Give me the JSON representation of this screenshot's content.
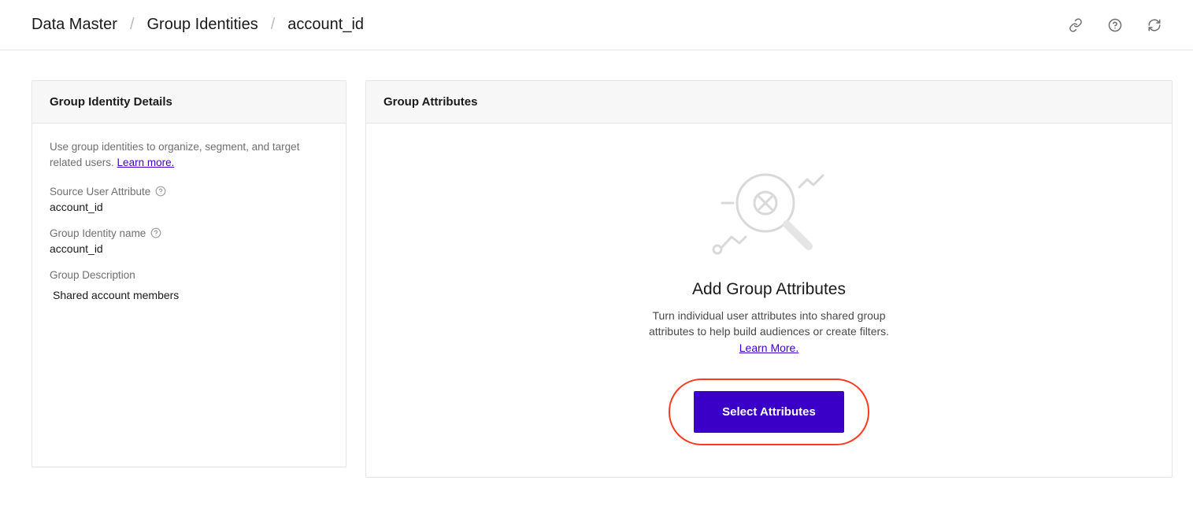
{
  "breadcrumb": {
    "root": "Data Master",
    "parent": "Group Identities",
    "current": "account_id"
  },
  "details_panel": {
    "title": "Group Identity Details",
    "intro_text": "Use group identities to organize, segment, and target related users. ",
    "learn_more": "Learn more.",
    "source_label": "Source User Attribute",
    "source_value": "account_id",
    "name_label": "Group Identity name",
    "name_value": "account_id",
    "desc_label": "Group Description",
    "desc_value": "Shared account members"
  },
  "attributes_panel": {
    "title": "Group Attributes",
    "empty_title": "Add Group Attributes",
    "empty_desc": "Turn individual user attributes into shared group attributes to help build audiences or create filters.",
    "learn_more": "Learn More.",
    "cta_label": "Select Attributes"
  }
}
